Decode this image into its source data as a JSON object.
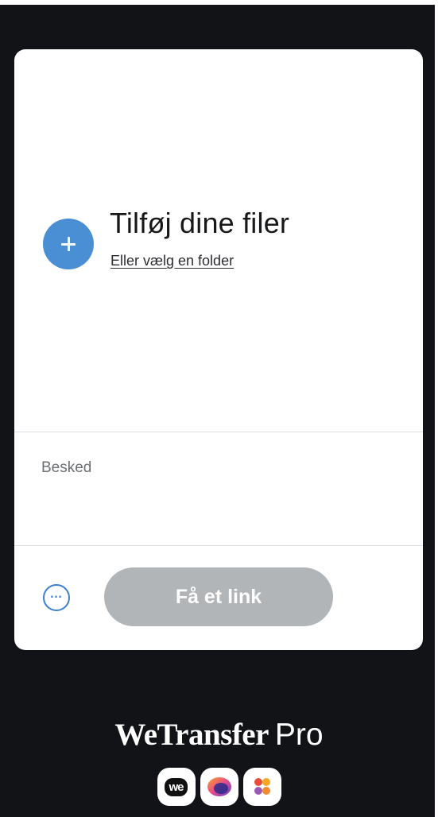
{
  "upload": {
    "title": "Tilføj dine filer",
    "folder_link": "Eller vælg en folder"
  },
  "message": {
    "placeholder": "Besked"
  },
  "footer": {
    "options_icon": "more-horizontal-icon",
    "get_link_label": "Få et link"
  },
  "brand": {
    "name": "WeTransfer",
    "suffix": "Pro",
    "app_icons": [
      {
        "name": "wetransfer-app-icon",
        "label": "we"
      },
      {
        "name": "collect-app-icon"
      },
      {
        "name": "paste-app-icon"
      }
    ]
  },
  "colors": {
    "accent": "#4a8fd4",
    "button_disabled": "#b2b5b8",
    "background": "#121317",
    "card": "#ffffff"
  }
}
